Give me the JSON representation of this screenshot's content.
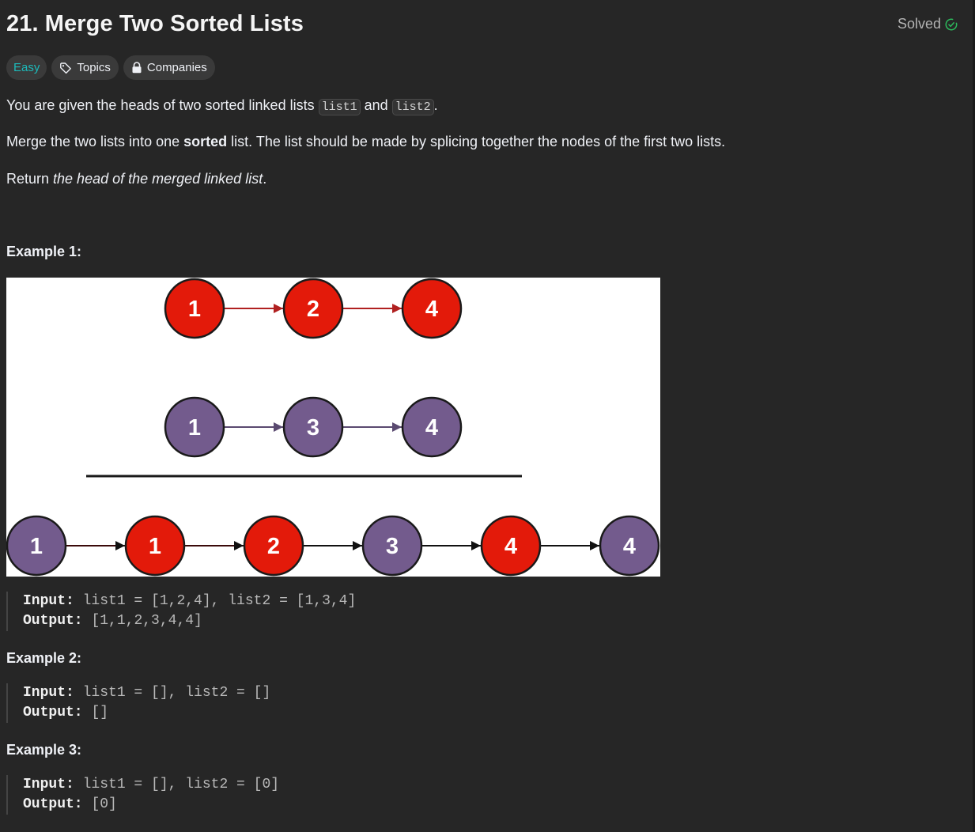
{
  "problem": {
    "title": "21. Merge Two Sorted Lists",
    "status": "Solved",
    "tags": {
      "difficulty": "Easy",
      "topics": "Topics",
      "companies": "Companies"
    }
  },
  "description": {
    "p1_prefix": "You are given the heads of two sorted linked lists ",
    "p1_code1": "list1",
    "p1_mid": " and ",
    "p1_code2": "list2",
    "p1_suffix": ".",
    "p2_prefix": "Merge the two lists into one ",
    "p2_bold": "sorted",
    "p2_suffix": " list. The list should be made by splicing together the nodes of the first two lists.",
    "p3_prefix": "Return ",
    "p3_italic": "the head of the merged linked list",
    "p3_suffix": "."
  },
  "examples": [
    {
      "label": "Example 1:",
      "input_label": "Input:",
      "input": "list1 = [1,2,4], list2 = [1,3,4]",
      "output_label": "Output:",
      "output": "[1,1,2,3,4,4]"
    },
    {
      "label": "Example 2:",
      "input_label": "Input:",
      "input": "list1 = [], list2 = []",
      "output_label": "Output:",
      "output": "[]"
    },
    {
      "label": "Example 3:",
      "input_label": "Input:",
      "input": "list1 = [], list2 = [0]",
      "output_label": "Output:",
      "output": "[0]"
    }
  ],
  "diagram": {
    "list1": [
      "1",
      "2",
      "4"
    ],
    "list2": [
      "1",
      "3",
      "4"
    ],
    "merged": [
      "1",
      "1",
      "2",
      "3",
      "4",
      "4"
    ],
    "merged_colors": [
      "purple",
      "red",
      "red",
      "purple",
      "red",
      "purple"
    ],
    "colors": {
      "red": "#e31a0a",
      "purple": "#735b8d",
      "red_arrow": "#b02020",
      "purple_arrow": "#5a4a70"
    }
  },
  "colors": {
    "accent_easy": "#1cbaba",
    "solved_check": "#2cbb5d"
  }
}
